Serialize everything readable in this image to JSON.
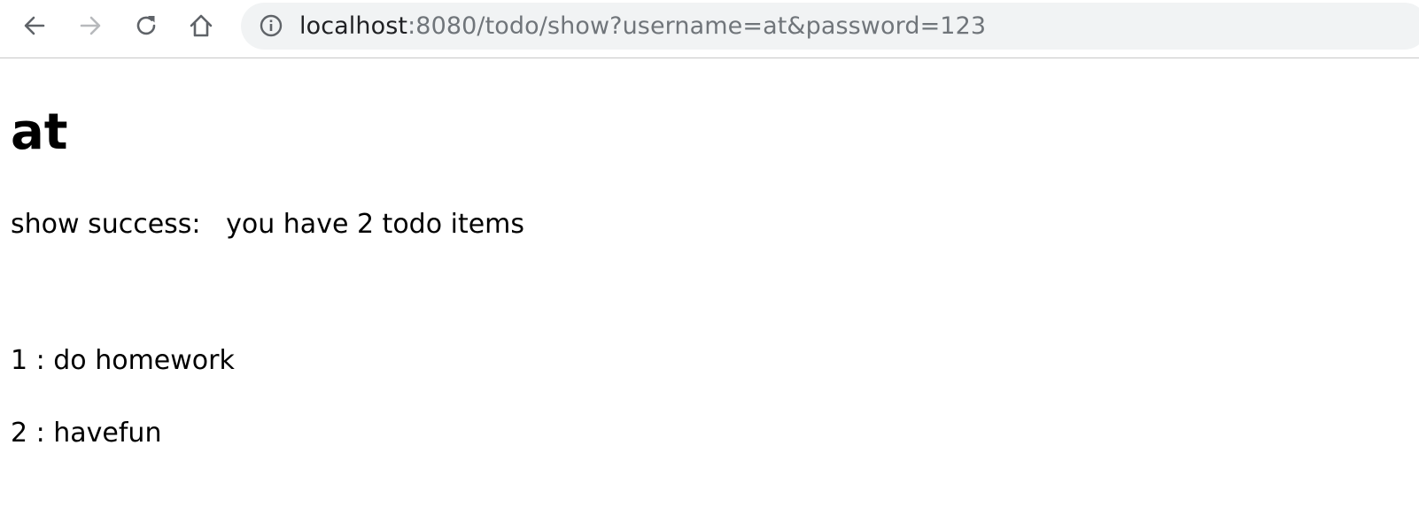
{
  "browser": {
    "address_bar": {
      "host": "localhost",
      "rest": ":8080/todo/show?username=at&password=123"
    },
    "icons": {
      "back": "back-arrow-icon",
      "forward": "forward-arrow-icon",
      "reload": "reload-icon",
      "home": "home-icon",
      "info": "info-icon"
    },
    "colors": {
      "omnibox_bg": "#f1f3f4",
      "icon_active": "#5f6368",
      "icon_disabled": "#b7b9bc",
      "url_host": "#202124",
      "url_rest": "#70757a"
    }
  },
  "page": {
    "title": "at",
    "status_text": "show success:   you have 2 todo items",
    "todo_items": [
      {
        "text": "1 : do homework"
      },
      {
        "text": "2 : havefun"
      }
    ]
  }
}
